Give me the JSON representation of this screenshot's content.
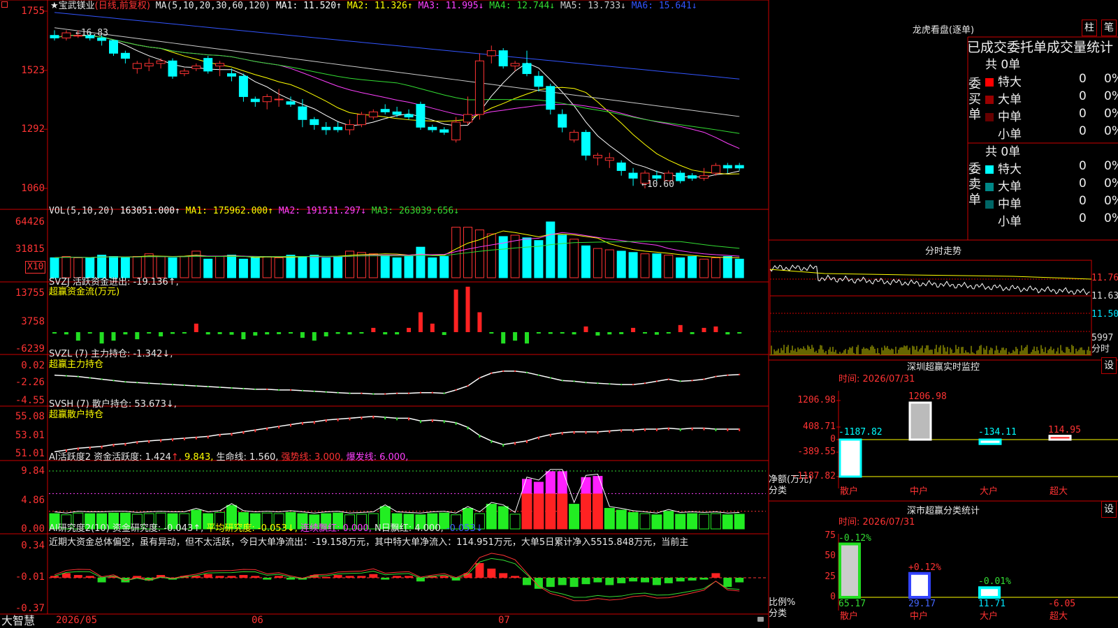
{
  "stock": {
    "name": "★宝武镁业",
    "period": "(日线,前复权)"
  },
  "main_legend": {
    "ma_params": "MA(5,10,20,30,60,120)",
    "items": [
      {
        "label": "MA1: 11.520↑",
        "color": "#ffffff"
      },
      {
        "label": "MA2: 11.326↑",
        "color": "#ffff00"
      },
      {
        "label": "MA3: 11.995↓",
        "color": "#ff40ff"
      },
      {
        "label": "MA4: 12.744↓",
        "color": "#33dd33"
      },
      {
        "label": "MA5: 13.733↓",
        "color": "#cccccc"
      },
      {
        "label": "MA6: 15.641↓",
        "color": "#3355ff"
      }
    ]
  },
  "main_axis": [
    "1755",
    "1523",
    "1292",
    "1060"
  ],
  "price_annotations": {
    "high": "16.83",
    "low": "10.60"
  },
  "price_chart": {
    "type": "candlestick",
    "ohlc": [
      [
        16.6,
        16.8,
        16.4,
        16.5
      ],
      [
        16.5,
        16.8,
        16.4,
        16.7
      ],
      [
        16.6,
        16.8,
        16.5,
        16.6
      ],
      [
        16.6,
        16.7,
        16.4,
        16.5
      ],
      [
        16.5,
        16.6,
        16.2,
        16.4
      ],
      [
        16.4,
        16.4,
        15.8,
        15.9
      ],
      [
        15.9,
        16.0,
        15.5,
        15.7
      ],
      [
        15.3,
        15.6,
        15.1,
        15.5
      ],
      [
        15.4,
        15.7,
        15.2,
        15.5
      ],
      [
        15.5,
        15.7,
        15.3,
        15.6
      ],
      [
        15.6,
        15.7,
        14.9,
        15.0
      ],
      [
        15.1,
        15.3,
        15.0,
        15.2
      ],
      [
        15.3,
        15.5,
        15.2,
        15.4
      ],
      [
        15.7,
        15.8,
        15.1,
        15.2
      ],
      [
        15.4,
        15.6,
        15.0,
        15.5
      ],
      [
        15.1,
        15.3,
        14.8,
        15.0
      ],
      [
        15.0,
        15.1,
        14.0,
        14.2
      ],
      [
        14.1,
        14.2,
        13.8,
        14.0
      ],
      [
        14.0,
        14.3,
        13.7,
        14.2
      ],
      [
        14.1,
        14.5,
        13.8,
        14.1
      ],
      [
        14.0,
        14.2,
        13.8,
        13.9
      ],
      [
        13.8,
        14.1,
        13.0,
        13.3
      ],
      [
        13.3,
        13.4,
        12.9,
        13.1
      ],
      [
        13.0,
        13.2,
        12.7,
        12.9
      ],
      [
        13.0,
        13.2,
        12.8,
        12.9
      ],
      [
        12.9,
        13.3,
        12.7,
        13.1
      ],
      [
        13.1,
        13.6,
        13.0,
        13.5
      ],
      [
        13.4,
        13.7,
        13.3,
        13.6
      ],
      [
        13.7,
        13.9,
        13.5,
        13.6
      ],
      [
        13.6,
        13.8,
        13.4,
        13.5
      ],
      [
        13.5,
        13.7,
        13.3,
        13.4
      ],
      [
        13.9,
        14.0,
        12.9,
        13.0
      ],
      [
        13.0,
        13.1,
        12.8,
        12.9
      ],
      [
        12.9,
        13.0,
        12.7,
        12.8
      ],
      [
        12.5,
        13.4,
        12.4,
        13.2
      ],
      [
        13.2,
        14.2,
        13.1,
        13.5
      ],
      [
        13.5,
        15.9,
        13.3,
        15.6
      ],
      [
        15.8,
        16.2,
        15.5,
        16.0
      ],
      [
        16.0,
        16.1,
        15.3,
        15.4
      ],
      [
        15.4,
        15.6,
        15.2,
        15.5
      ],
      [
        15.5,
        16.0,
        15.0,
        15.1
      ],
      [
        15.0,
        15.2,
        14.4,
        14.6
      ],
      [
        14.6,
        14.7,
        13.5,
        13.7
      ],
      [
        13.5,
        13.7,
        12.8,
        13.0
      ],
      [
        12.5,
        12.9,
        12.4,
        12.8
      ],
      [
        12.8,
        12.9,
        11.7,
        11.9
      ],
      [
        11.8,
        12.0,
        11.5,
        11.9
      ],
      [
        11.7,
        12.0,
        11.4,
        11.8
      ],
      [
        11.6,
        11.7,
        11.1,
        11.3
      ],
      [
        11.2,
        11.4,
        10.7,
        11.0
      ],
      [
        10.8,
        11.3,
        10.6,
        11.2
      ],
      [
        11.1,
        11.3,
        10.9,
        11.0
      ],
      [
        10.9,
        11.3,
        10.9,
        11.2
      ],
      [
        11.2,
        11.3,
        10.8,
        10.9
      ],
      [
        11.1,
        11.2,
        10.9,
        11.0
      ],
      [
        11.0,
        11.4,
        10.9,
        11.1
      ],
      [
        11.2,
        11.6,
        11.1,
        11.5
      ],
      [
        11.5,
        11.6,
        11.2,
        11.4
      ],
      [
        11.5,
        11.6,
        11.3,
        11.4
      ]
    ]
  },
  "vol_legend": {
    "params": "VOL(5,10,20)",
    "items": [
      {
        "label": "163051.000↑",
        "color": "#ffffff"
      },
      {
        "label": "MA1: 175962.000↑",
        "color": "#ffff00"
      },
      {
        "label": "MA2: 191511.297↓",
        "color": "#ff40ff"
      },
      {
        "label": "MA3: 263039.656↓",
        "color": "#33dd33"
      }
    ]
  },
  "vol_axis": [
    "64426",
    "31815"
  ],
  "vol_unit": "X10",
  "vol_values": [
    150,
    160,
    150,
    150,
    170,
    160,
    150,
    160,
    180,
    160,
    150,
    160,
    200,
    140,
    160,
    170,
    140,
    150,
    160,
    150,
    170,
    160,
    170,
    150,
    160,
    200,
    190,
    180,
    170,
    150,
    160,
    230,
    150,
    160,
    380,
    380,
    360,
    330,
    310,
    320,
    300,
    280,
    420,
    320,
    290,
    240,
    220,
    210,
    200,
    190,
    180,
    180,
    170,
    150,
    160,
    140,
    150,
    160,
    140
  ],
  "svzj": {
    "title": "SVZJ  活跃资金进出: -19.136↑,",
    "subtitle": "超赢资金流(万元)",
    "axis": [
      "13755",
      "3758",
      "-6239"
    ],
    "values": [
      -500,
      -800,
      -3000,
      -500,
      -4000,
      -3000,
      -800,
      -2500,
      -500,
      -1500,
      -600,
      -400,
      3000,
      -800,
      -700,
      -900,
      -2500,
      -1200,
      -800,
      -700,
      -500,
      -2000,
      -3000,
      -1500,
      -600,
      -800,
      -500,
      1500,
      -800,
      -800,
      1500,
      7000,
      3000,
      -1000,
      15000,
      16000,
      7000,
      -500,
      -4000,
      -3000,
      -4000,
      -400,
      -600,
      -500,
      -800,
      2000,
      -1200,
      -800,
      -700,
      1500,
      -500,
      -900,
      -400,
      2500,
      -700,
      1500,
      2000,
      -800,
      -500
    ]
  },
  "svzl": {
    "title": "SVZL (7) 主力持仓: -1.342↓,",
    "subtitle": "超赢主力持仓",
    "axis": [
      "0.02",
      "-2.26",
      "-4.55"
    ],
    "values": [
      -1.4,
      -1.5,
      -1.6,
      -1.8,
      -2.0,
      -2.2,
      -2.4,
      -2.5,
      -2.6,
      -2.7,
      -2.8,
      -2.9,
      -3.0,
      -3.1,
      -3.2,
      -3.3,
      -3.4,
      -3.5,
      -3.5,
      -3.6,
      -3.6,
      -3.7,
      -3.8,
      -3.9,
      -4.0,
      -4.1,
      -4.1,
      -4.2,
      -4.2,
      -4.1,
      -4.1,
      -4.0,
      -4.0,
      -4.1,
      -3.6,
      -3.0,
      -1.8,
      -1.1,
      -0.8,
      -0.8,
      -1.0,
      -1.4,
      -1.8,
      -2.2,
      -2.3,
      -2.5,
      -2.6,
      -2.7,
      -2.8,
      -2.8,
      -2.6,
      -2.3,
      -2.0,
      -2.3,
      -2.2,
      -2.0,
      -1.6,
      -1.4,
      -1.3
    ]
  },
  "svsh": {
    "title": "SVSH (7) 散户持仓: 53.673↓,",
    "subtitle": "超赢散户持仓",
    "axis": [
      "55.08",
      "53.01",
      "51.01"
    ],
    "values": [
      51.2,
      51.4,
      51.6,
      51.7,
      51.8,
      52.0,
      52.1,
      52.3,
      52.4,
      52.5,
      52.6,
      52.7,
      52.8,
      52.9,
      53.1,
      53.2,
      53.4,
      53.6,
      53.8,
      54.0,
      54.2,
      54.4,
      54.5,
      54.7,
      54.8,
      54.9,
      55.0,
      55.1,
      55.0,
      54.9,
      54.9,
      54.6,
      54.7,
      54.6,
      54.4,
      53.9,
      53.0,
      52.4,
      52.0,
      52.2,
      52.4,
      52.8,
      53.1,
      53.3,
      53.4,
      53.4,
      53.4,
      53.5,
      53.6,
      53.6,
      53.7,
      53.7,
      53.8,
      53.7,
      53.8,
      53.8,
      53.7,
      53.7,
      53.7
    ]
  },
  "ai_active": {
    "title": "AI活跃度2 资金活跃度: 1.424",
    "v1": "9.843,",
    "life": "生命线: 1.560,",
    "strong": "强势线: 3.000,",
    "burst": "爆发线: 6.000,",
    "axis": [
      "9.84",
      "4.86",
      "0.00"
    ],
    "values": [
      2.6,
      2.4,
      2.7,
      2.6,
      2.6,
      2.7,
      2.7,
      2.5,
      2.6,
      2.7,
      2.6,
      2.6,
      3.2,
      2.6,
      2.8,
      4.0,
      2.8,
      2.6,
      2.7,
      2.6,
      2.8,
      2.6,
      2.4,
      2.6,
      2.7,
      2.4,
      2.5,
      2.6,
      3.8,
      2.6,
      2.5,
      2.4,
      2.6,
      2.7,
      2.4,
      3.5,
      2.6,
      4.2,
      3.8,
      2.5,
      8.5,
      8.0,
      9.8,
      9.8,
      4.2,
      8.8,
      9.0,
      3.5,
      3.2,
      2.8,
      2.6,
      2.4,
      3.0,
      2.5,
      2.6,
      2.5,
      2.6,
      2.4,
      2.5
    ]
  },
  "ai_research": {
    "title": "AI研究度2(10) 资金研究度: -0.043↑,",
    "avg": "平均研究度: -0.053↓,",
    "streak": "连续飘红: 0.000,",
    "nday": "N日飘红: 4.000,",
    "last": "-0.053↓",
    "axis": [
      "0.34",
      "-0.01",
      "-0.37"
    ],
    "comment": "近期大资金总体偏空，虽有异动，但不太活跃，今日大单净流出：-19.158万元，其中特大单净流入：114.951万元，大单5日累计净入5515.848万元，当前主",
    "values": [
      0.02,
      0.05,
      0.03,
      0.02,
      -0.05,
      0.02,
      -0.05,
      0.02,
      -0.03,
      0.03,
      -0.02,
      0.02,
      0.02,
      0.04,
      0.02,
      0.02,
      0.03,
      0.02,
      -0.02,
      0.02,
      -0.02,
      -0.02,
      0.03,
      0.01,
      0.03,
      0.02,
      0.02,
      0.04,
      -0.02,
      0.02,
      0.02,
      -0.04,
      0.02,
      0.02,
      -0.03,
      0.05,
      0.16,
      0.1,
      0.05,
      0.02,
      -0.08,
      -0.12,
      -0.1,
      -0.08,
      -0.1,
      -0.07,
      -0.05,
      -0.08,
      -0.06,
      -0.04,
      -0.05,
      -0.08,
      -0.06,
      -0.04,
      -0.03,
      -0.02,
      0.05,
      -0.1,
      -0.05
    ]
  },
  "date_axis": [
    "2026/05",
    "06",
    "07"
  ],
  "right_panel": {
    "lhb_title": "龙虎看盘(逐单)",
    "btn1": "柱",
    "btn2": "笔",
    "tabs": "已成交委托单成交量统计",
    "buy": {
      "side": "委买单",
      "total": "共 0单",
      "rows": [
        {
          "name": "特大",
          "color": "#ff0000",
          "n": "0",
          "p": "0%"
        },
        {
          "name": "大单",
          "color": "#990000",
          "n": "0",
          "p": "0%"
        },
        {
          "name": "中单",
          "color": "#660000",
          "n": "0",
          "p": "0%"
        },
        {
          "name": "小单",
          "color": "",
          "n": "0",
          "p": "0%"
        }
      ]
    },
    "sell": {
      "side": "委卖单",
      "total": "共 0单",
      "rows": [
        {
          "name": "特大",
          "color": "#00ffff",
          "n": "0",
          "p": "0%"
        },
        {
          "name": "大单",
          "color": "#008888",
          "n": "0",
          "p": "0%"
        },
        {
          "name": "中单",
          "color": "#006666",
          "n": "0",
          "p": "0%"
        },
        {
          "name": "小单",
          "color": "",
          "n": "0",
          "p": "0%"
        }
      ]
    },
    "fenshi": {
      "title": "分时走势",
      "prices": [
        "11.76",
        "11.63",
        "11.50"
      ],
      "vol": "5997",
      "vol_label": "分时"
    },
    "monitor": {
      "title": "深圳超赢实时监控",
      "btn": "设",
      "time": "时间: 2026/07/31",
      "axis": [
        "1206.98",
        "408.71",
        "0",
        "-389.55",
        "-1187.82"
      ],
      "ylabel": "净额(万元)",
      "xlabel": "分类",
      "bars": [
        {
          "label": "散户",
          "value": -1187.82,
          "text": "-1187.82"
        },
        {
          "label": "中户",
          "value": 1206.98,
          "text": "1206.98"
        },
        {
          "label": "大户",
          "value": -134.11,
          "text": "-134.11"
        },
        {
          "label": "超大",
          "value": 114.95,
          "text": "114.95"
        }
      ]
    },
    "stats": {
      "title": "深市超赢分类统计",
      "btn": "设",
      "time": "时间: 2026/07/31",
      "axis": [
        "75",
        "50",
        "25",
        "0"
      ],
      "ylabel": "比例%",
      "xlabel": "分类",
      "bars": [
        {
          "label": "散户",
          "value": 65.17,
          "pct": "-0.12%",
          "val": "65.17"
        },
        {
          "label": "中户",
          "value": 29.17,
          "pct": "+0.12%",
          "val": "29.17"
        },
        {
          "label": "大户",
          "value": 11.71,
          "pct": "-0.01%",
          "val": "11.71"
        },
        {
          "label": "超大",
          "value": -6.05,
          "pct": "",
          "val": "-6.05"
        }
      ]
    }
  },
  "footer": {
    "logo": "大智慧"
  }
}
